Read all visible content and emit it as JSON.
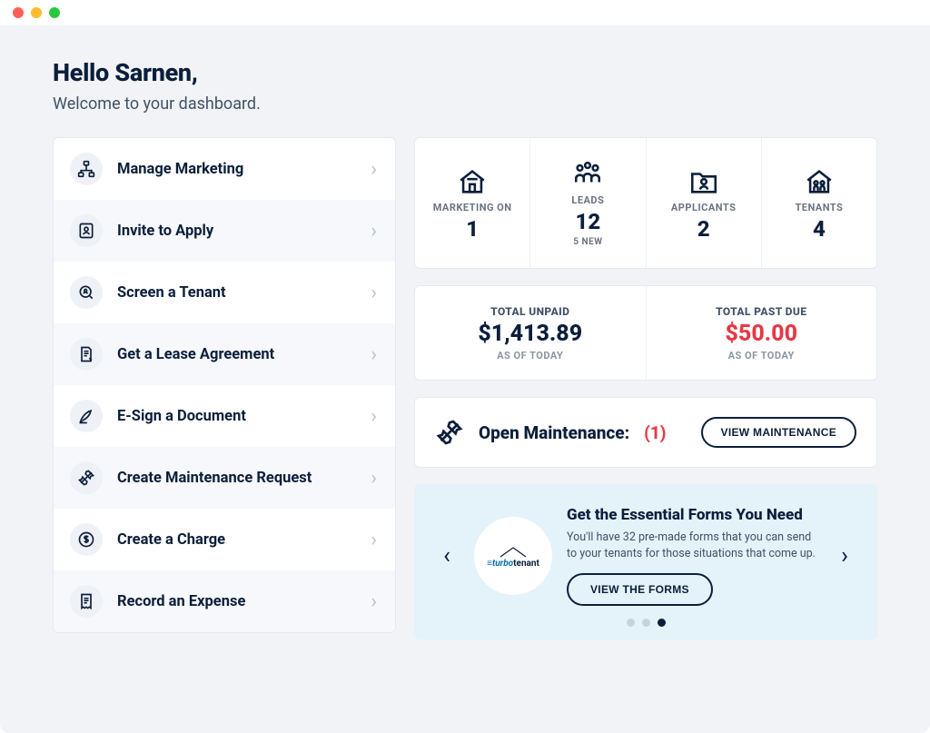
{
  "greeting": {
    "title": "Hello Sarnen,",
    "subtitle": "Welcome to your dashboard."
  },
  "actions": [
    {
      "label": "Manage Marketing"
    },
    {
      "label": "Invite to Apply"
    },
    {
      "label": "Screen a Tenant"
    },
    {
      "label": "Get a Lease Agreement"
    },
    {
      "label": "E-Sign a Document"
    },
    {
      "label": "Create Maintenance Request"
    },
    {
      "label": "Create a Charge"
    },
    {
      "label": "Record an Expense"
    }
  ],
  "stats": {
    "marketing": {
      "label": "MARKETING ON",
      "value": "1",
      "sub": ""
    },
    "leads": {
      "label": "LEADS",
      "value": "12",
      "sub": "5 NEW"
    },
    "applicants": {
      "label": "APPLICANTS",
      "value": "2",
      "sub": ""
    },
    "tenants": {
      "label": "TENANTS",
      "value": "4",
      "sub": ""
    }
  },
  "totals": {
    "unpaid": {
      "label": "TOTAL UNPAID",
      "value": "$1,413.89",
      "asof": "AS OF TODAY"
    },
    "pastdue": {
      "label": "TOTAL PAST DUE",
      "value": "$50.00",
      "asof": "AS OF TODAY"
    }
  },
  "maintenance": {
    "title": "Open Maintenance:",
    "count": "(1)",
    "button": "VIEW MAINTENANCE"
  },
  "promo": {
    "logo_text": "turbotenant",
    "title": "Get the Essential Forms You Need",
    "desc": "You'll have 32 pre-made forms that you can send to your tenants for those situations that come up.",
    "button": "VIEW THE FORMS"
  }
}
